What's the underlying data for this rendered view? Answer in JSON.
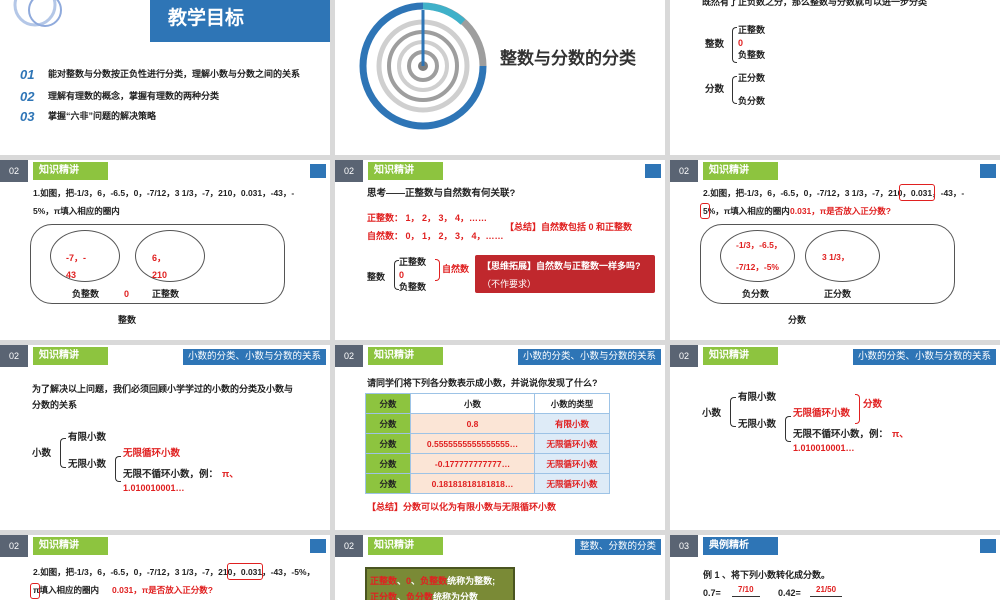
{
  "s1": {
    "title": "教学目标",
    "items": [
      {
        "n": "01",
        "text": "能对整数与分数按正负性进行分类，理解小数与分数之间的关系"
      },
      {
        "n": "02",
        "text": "理解有理数的概念，掌握有理数的两种分类"
      },
      {
        "n": "03",
        "text": "掌握“六非”问题的解决策略"
      }
    ]
  },
  "s2": {
    "title": "整数与分数的分类"
  },
  "s3": {
    "intro": "既然有了正负数之分，那么整数与分数就可以进一步分类",
    "int_label": "整数",
    "int_items": [
      "正整数",
      "0",
      "负整数"
    ],
    "frac_label": "分数",
    "frac_items": [
      "正分数",
      "负分数"
    ]
  },
  "hdr": {
    "num": "02",
    "tag": "知识精讲",
    "num3": "03",
    "tag3": "典例精析"
  },
  "s4": {
    "q": "1.如图，把-1/3，6，-6.5，0，-7/12，3 1/3，-7，210，0.031，-43，-",
    "q2": "5%，π填入相应的圈内",
    "left": [
      "-7，-",
      "43"
    ],
    "right": [
      "6，",
      "210"
    ],
    "neg": "负整数",
    "zero": "0",
    "pos": "正整数",
    "whole": "整数"
  },
  "s5": {
    "think": "思考——正整数与自然数有何关联?",
    "pos_row": "正整数： 1， 2， 3， 4，……",
    "nat_row": "自然数： 0， 1， 2， 3， 4，……",
    "summary": "【总结】自然数包括 0 和正整数",
    "int_label": "整数",
    "int_items": [
      "正整数",
      "0",
      "负整数"
    ],
    "natural": "自然数",
    "ext1": "【思维拓展】自然数与正整数一样多吗?",
    "ext2": "（不作要求）"
  },
  "s6": {
    "q": "2.如图，把-1/3，6，-6.5，0，-7/12，3 1/3，-7，210，0.031，-43，-",
    "q2a": "5%，π填入相应的圈内",
    "red_q": "0.031，π是否放入正分数?",
    "left": [
      "-1/3，-6.5，",
      "-7/12，-5%"
    ],
    "right": "3 1/3，",
    "neg": "负分数",
    "pos": "正分数",
    "whole": "分数"
  },
  "s7": {
    "topic": "小数的分类、小数与分数的关系",
    "l1": "为了解决以上问题，我们必须回顾小学学过的小数的分类及小数与",
    "l2": "分数的关系",
    "dec": "小数",
    "finite": "有限小数",
    "infinite": "无限小数",
    "rep": "无限循环小数",
    "nonrep": "无限不循环小数，例：",
    "pi": "π、",
    "ex": "1.010010001…"
  },
  "s8": {
    "topic": "小数的分类、小数与分数的关系",
    "q": "请同学们将下列各分数表示成小数，并说说你发现了什么?",
    "headers": [
      "分数",
      "小数",
      "小数的类型"
    ],
    "rows": [
      [
        "分数",
        "0.8",
        "有限小数"
      ],
      [
        "分数",
        "0.5555555555555555…",
        "无限循环小数"
      ],
      [
        "分数",
        "-0.177777777777…",
        "无限循环小数"
      ],
      [
        "分数",
        "0.18181818181818…",
        "无限循环小数"
      ]
    ],
    "summary": "【总结】分数可以化为有限小数与无限循环小数"
  },
  "s9": {
    "topic": "小数的分类、小数与分数的关系",
    "dec": "小数",
    "finite": "有限小数",
    "infinite": "无限小数",
    "rep": "无限循环小数",
    "frac": "分数",
    "nonrep": "无限不循环小数，例：",
    "pi": "π、",
    "ex": "1.010010001…"
  },
  "s10": {
    "q": "2.如图，把-1/3，6，-6.5，0，-7/12，3 1/3，-7，210，0.031，-43，-5%，",
    "q2": "π填入相应的圈内",
    "red_q": "0.031，π是否放入正分数?"
  },
  "s11": {
    "topic": "整数、分数的分类",
    "l1a": "正整数",
    "l1b": "、",
    "l1c": "0",
    "l1d": "、",
    "l1e": "负整数",
    "l1f": "统称为整数;",
    "l2a": "正分数",
    "l2b": "、",
    "l2c": "负分数",
    "l2d": "统称为分数"
  },
  "s12": {
    "ex": "例 1 、将下列小数转化成分数。",
    "a": "0.7=",
    "a_val": "7/10",
    "b": "0.42=",
    "b_val": "21/50"
  }
}
